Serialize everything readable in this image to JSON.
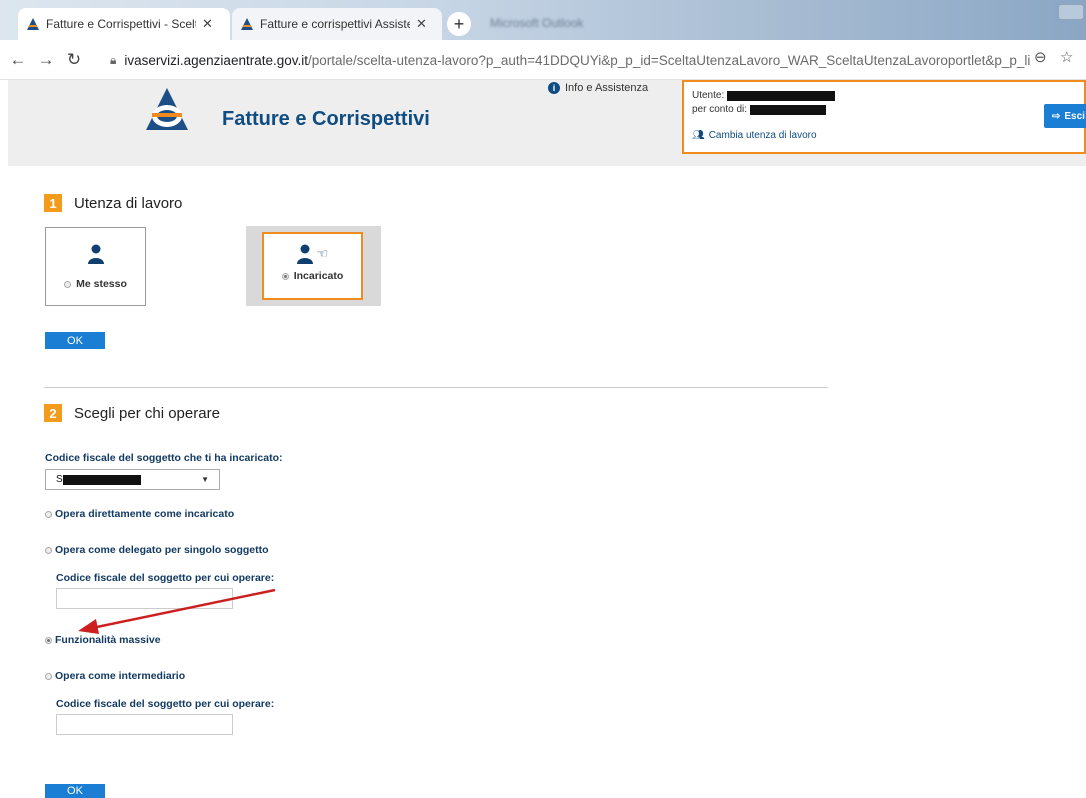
{
  "browser": {
    "tabs": [
      {
        "title": "Fatture e Corrispettivi - Scelta ute",
        "active": true
      },
      {
        "title": "Fatture e corrispettivi Assistenza",
        "active": false
      }
    ],
    "blurred_window_title": "Microsoft Outlook",
    "url_host": "ivaservizi.agenziaentrate.gov.it",
    "url_path": "/portale/scelta-utenza-lavoro?p_auth=41DDQUYi&p_p_id=SceltaUtenzaLavoro_WAR_SceltaUtenzaLavoroportlet&p_p_lifecycle=..."
  },
  "header": {
    "title": "Fatture e Corrispettivi",
    "info_link": "Info e Assistenza",
    "user_label": "Utente:",
    "on_behalf_label": "per conto di:",
    "change_link": "Cambia utenza di lavoro",
    "logout_label": "Esci"
  },
  "step1": {
    "number": "1",
    "title": "Utenza di lavoro",
    "options": [
      {
        "label": "Me stesso",
        "selected": false
      },
      {
        "label": "Incaricato",
        "selected": true
      }
    ],
    "ok_label": "OK"
  },
  "step2": {
    "number": "2",
    "title": "Scegli per chi operare",
    "delegator_label": "Codice fiscale del soggetto che ti ha incaricato:",
    "delegator_value_prefix": "S",
    "options": [
      {
        "label": "Opera direttamente come incaricato",
        "selected": false
      },
      {
        "label": "Opera come delegato per singolo soggetto",
        "selected": false
      },
      {
        "label": "Funzionalità massive",
        "selected": true
      },
      {
        "label": "Opera come intermediario",
        "selected": false
      }
    ],
    "fiscal_code_label": "Codice fiscale del soggetto per cui operare:",
    "ok_label": "OK"
  },
  "colors": {
    "accent_orange": "#f39c1b",
    "brand_blue": "#0f4c81",
    "button_blue": "#1a7fd4",
    "annotation_red": "#cc1f1f"
  }
}
